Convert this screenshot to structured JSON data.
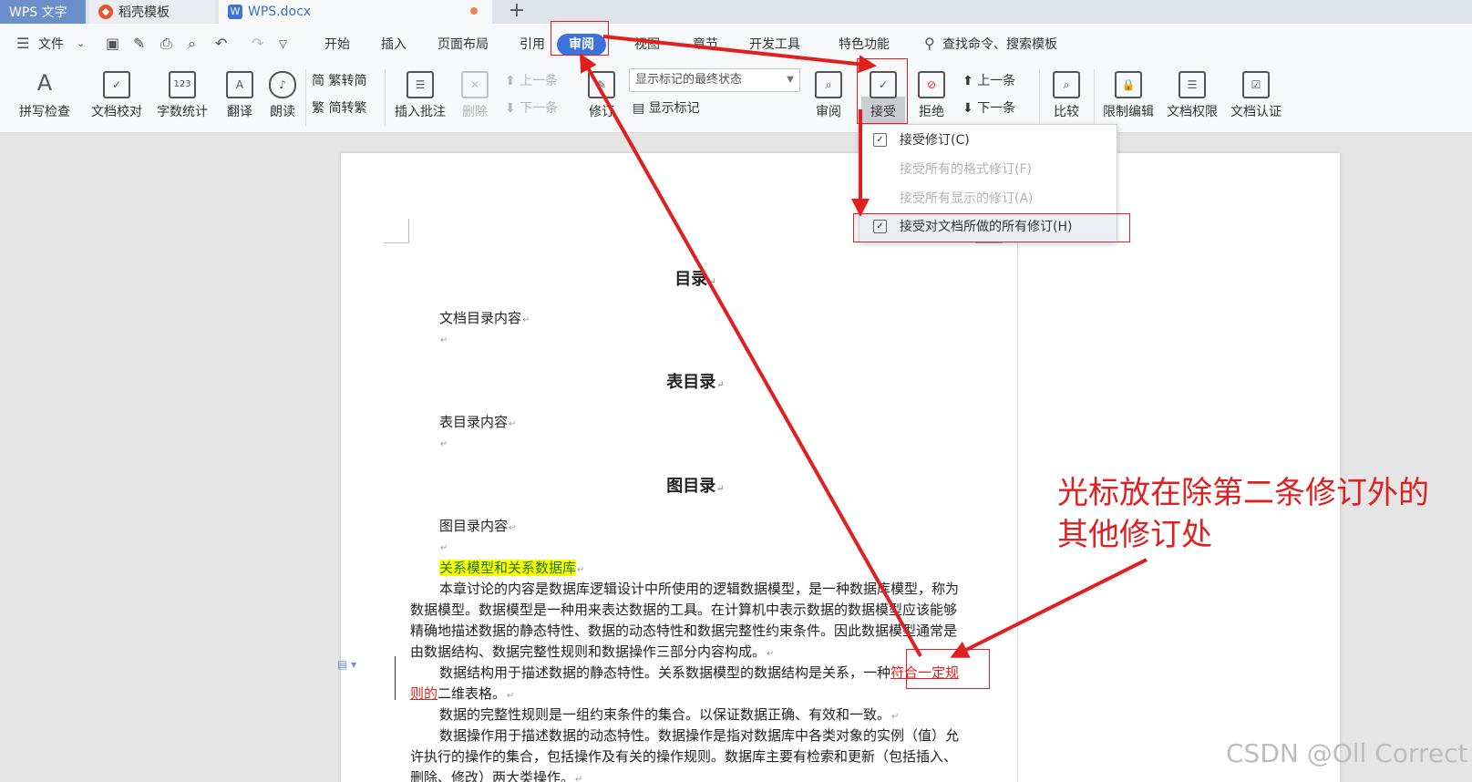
{
  "tabs": {
    "wps": "WPS 文字",
    "daoke": "稻壳模板",
    "doc": "WPS.docx",
    "new": "+"
  },
  "menu": {
    "file": "文件",
    "items": [
      "开始",
      "插入",
      "页面布局",
      "引用",
      "审阅",
      "视图",
      "章节",
      "开发工具",
      "特色功能"
    ],
    "search": "查找命令、搜索模板"
  },
  "ribbon": {
    "spell": "拼写检查",
    "doccheck": "文档校对",
    "wordcount": "字数统计",
    "translate": "翻译",
    "read": "朗读",
    "to_simplified": "繁转简",
    "to_traditional": "简转繁",
    "insert_comment": "插入批注",
    "delete": "删除",
    "prev_comment": "上一条",
    "next_comment": "下一条",
    "track": "修订",
    "display_state": "显示标记的最终状态",
    "show_markup": "显示标记",
    "review_pane": "审阅",
    "accept": "接受",
    "reject": "拒绝",
    "prev": "上一条",
    "next": "下一条",
    "compare": "比较",
    "restrict": "限制编辑",
    "permission": "文档权限",
    "certify": "文档认证"
  },
  "dropdown": [
    "接受修订(C)",
    "接受所有的格式修订(F)",
    "接受所有显示的修订(A)",
    "接受对文档所做的所有修订(H)"
  ],
  "doc": {
    "h_toc": "目录",
    "toc_content": "文档目录内容",
    "h_tables": "表目录",
    "tables_content": "表目录内容",
    "h_figures": "图目录",
    "figures_content": "图目录内容",
    "section_title": "关系模型和关系数据库",
    "para1": [
      "本章讨论的内容是数据库逻辑设计中所使用的逻辑数据模型，是一种数据库模型，称为",
      "数据模型。数据模型是一种用来表达数据的工具。在计算机中表示数据的数据模型应该能够",
      "精确地描述数据的静态特性、数据的动态特性和数据完整性约束条件。因此数据模型通常是",
      "由数据结构、数据完整性规则和数据操作三部分内容构成。"
    ],
    "para2_a": "数据结构用于描述数据的静态特性。关系数据模型的数据结构是关系，一种",
    "para2_rev1": "符合一定规",
    "para2_rev2": "则的",
    "para2_b": "二维表格。",
    "para3": "数据的完整性规则是一组约束条件的集合。以保证数据正确、有效和一致。",
    "para4": [
      "数据操作用于描述数据的动态特性。数据操作是指对数据库中各类对象的实例（值）允",
      "许执行的操作的集合，包括操作及有关的操作规则。数据库主要有检索和更新（包括插入、",
      "删除、修改）两大类操作。"
    ]
  },
  "annotation": [
    "光标放在除第二条修订外的",
    "其他修订处"
  ],
  "watermark": "CSDN @Oll Correct",
  "colors": {
    "accent": "#3c72e0",
    "annotation_red": "#e02020",
    "highlight": "#ffff00"
  }
}
